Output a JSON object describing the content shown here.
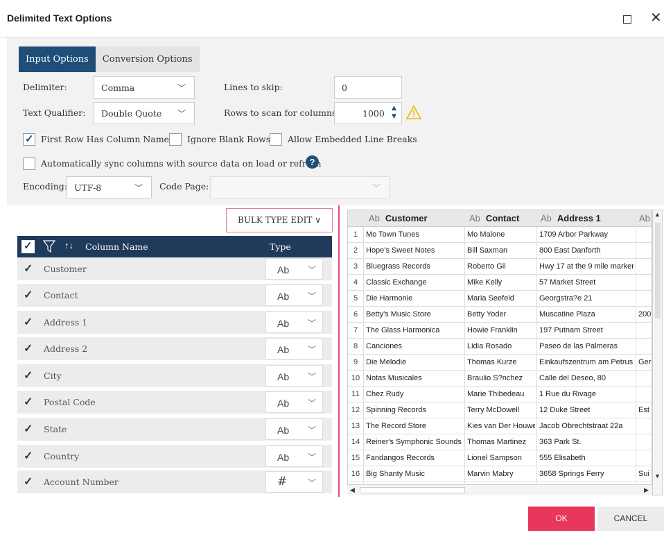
{
  "window": {
    "title": "Delimited Text Options"
  },
  "tabs": [
    {
      "label": "Input Options",
      "active": true
    },
    {
      "label": "Conversion Options",
      "active": false
    }
  ],
  "options": {
    "delimiter_label": "Delimiter:",
    "delimiter_value": "Comma",
    "lines_to_skip_label": "Lines to skip:",
    "lines_to_skip_value": "0",
    "text_qualifier_label": "Text Qualifier:",
    "text_qualifier_value": "Double Quote",
    "rows_to_scan_label": "Rows to scan for columns:",
    "rows_to_scan_value": "1000",
    "first_row_label": "First Row Has Column Names",
    "first_row_checked": true,
    "ignore_blank_label": "Ignore Blank Rows",
    "ignore_blank_checked": false,
    "embedded_breaks_label": "Allow Embedded Line Breaks",
    "embedded_breaks_checked": false,
    "auto_sync_label": "Automatically sync columns with source data on load or refresh",
    "auto_sync_checked": false,
    "encoding_label": "Encoding:",
    "encoding_value": "UTF-8",
    "code_page_label": "Code Page:",
    "code_page_value": ""
  },
  "bulk_type_edit": "BULK TYPE EDIT ∨",
  "column_list": {
    "header_name": "Column Name",
    "header_type": "Type",
    "rows": [
      {
        "name": "Customer",
        "type": "Ab"
      },
      {
        "name": "Contact",
        "type": "Ab"
      },
      {
        "name": "Address 1",
        "type": "Ab"
      },
      {
        "name": "Address 2",
        "type": "Ab"
      },
      {
        "name": "City",
        "type": "Ab"
      },
      {
        "name": "Postal Code",
        "type": "Ab"
      },
      {
        "name": "State",
        "type": "Ab"
      },
      {
        "name": "Country",
        "type": "Ab"
      },
      {
        "name": "Account Number",
        "type": "#"
      }
    ]
  },
  "preview": {
    "type_prefix": "Ab",
    "headers": [
      "Customer",
      "Contact",
      "Address 1"
    ],
    "rows": [
      {
        "n": "1",
        "c": [
          "Mo Town Tunes",
          "Mo Malone",
          "1709 Arbor Parkway",
          ""
        ]
      },
      {
        "n": "2",
        "c": [
          "Hope's Sweet Notes",
          "Bill Saxman",
          "800 East Danforth",
          ""
        ]
      },
      {
        "n": "3",
        "c": [
          "Bluegrass Records",
          "Roberto Gil",
          "Hwy 17 at the 9 mile marker",
          ""
        ]
      },
      {
        "n": "4",
        "c": [
          "Classic Exchange",
          "Mike Kelly",
          "57 Market Street",
          ""
        ]
      },
      {
        "n": "5",
        "c": [
          "Die Harmonie",
          "Maria Seefeld",
          "Georgstra?e 21",
          ""
        ]
      },
      {
        "n": "6",
        "c": [
          "Betty's Music Store",
          "Betty Yoder",
          "Muscatine Plaza",
          "200"
        ]
      },
      {
        "n": "7",
        "c": [
          "The Glass Harmonica",
          "Howie Franklin",
          "197 Putnam Street",
          ""
        ]
      },
      {
        "n": "8",
        "c": [
          "Canciones",
          "Lidia Rosado",
          "Paseo de las Palmeras",
          ""
        ]
      },
      {
        "n": "9",
        "c": [
          "Die Melodie",
          "Thomas Kurze",
          "Einkaufszentrum am Petrus",
          "Ger"
        ]
      },
      {
        "n": "10",
        "c": [
          "Notas Musicales",
          "Braulio S?nchez",
          "Calle del Deseo, 80",
          ""
        ]
      },
      {
        "n": "11",
        "c": [
          "Chez Rudy",
          "Marie Thibedeau",
          "1 Rue du Rivage",
          ""
        ]
      },
      {
        "n": "12",
        "c": [
          "Spinning Records",
          "Terry McDowell",
          "12 Duke Street",
          "Est"
        ]
      },
      {
        "n": "13",
        "c": [
          "The Record Store",
          "Kies van Der Houwe",
          "Jacob Obrechtstraat 22a",
          ""
        ]
      },
      {
        "n": "14",
        "c": [
          "Reiner's Symphonic Sounds",
          "Thomas Martinez",
          "363 Park St.",
          ""
        ]
      },
      {
        "n": "15",
        "c": [
          "Fandangos Records",
          "Lionel Sampson",
          "555 Elisabeth",
          ""
        ]
      },
      {
        "n": "16",
        "c": [
          "Big Shanty Music",
          "Marvin Mabry",
          "3658 Springs Ferry",
          "Sui"
        ]
      }
    ]
  },
  "footer": {
    "ok_label": "OK",
    "cancel_label": "CANCEL"
  },
  "colors": {
    "accent": "#1f4e79",
    "header_dark": "#1f3a5a",
    "ok": "#e8365d",
    "warning": "#f0b400"
  },
  "icons": [
    "maximize-icon",
    "close-icon",
    "chevron-down-icon",
    "spinner-icon",
    "warning-icon",
    "help-icon",
    "filter-icon",
    "sort-icon",
    "checkmark-icon"
  ]
}
